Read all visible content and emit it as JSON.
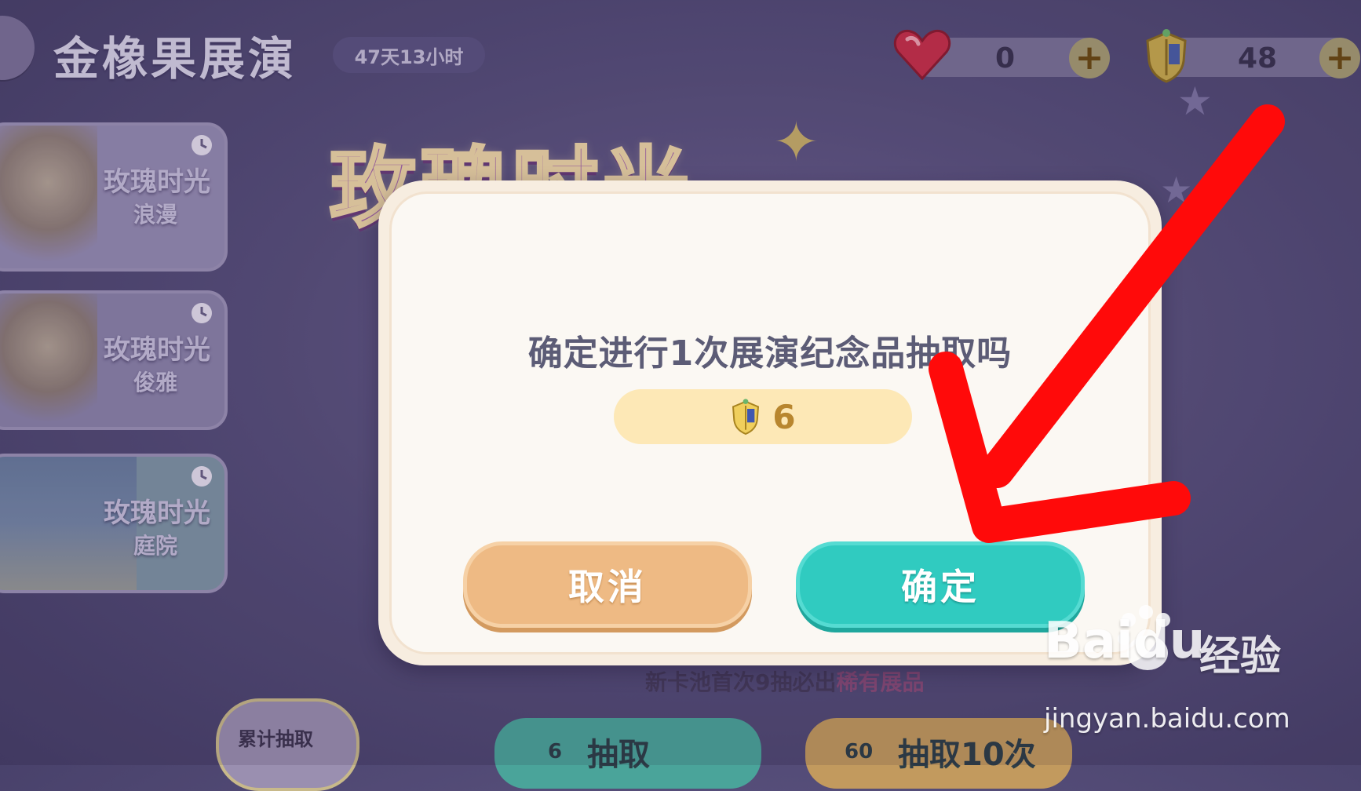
{
  "header": {
    "title": "金橡果展演",
    "countdown": "47天13小时",
    "currencies": [
      {
        "icon": "heart-gem-icon",
        "value": "0",
        "add_label": "+"
      },
      {
        "icon": "shield-token-icon",
        "value": "48",
        "add_label": "+"
      }
    ]
  },
  "sidebar": {
    "cards": [
      {
        "title": "玫瑰时光",
        "subtitle": "浪漫"
      },
      {
        "title": "玫瑰时光",
        "subtitle": "俊雅"
      },
      {
        "title": "玫瑰时光",
        "subtitle": "庭院"
      }
    ]
  },
  "banner": {
    "title": "玫瑰时光"
  },
  "background": {
    "notice_prefix": "新卡池首次9抽必出",
    "notice_highlight": "稀有展品",
    "accumulate_label": "累计抽取",
    "draw_one_label": "抽取",
    "draw_one_cost": "6",
    "draw_ten_label": "抽取10次",
    "draw_ten_cost": "60"
  },
  "dialog": {
    "question": "确定进行1次展演纪念品抽取吗",
    "cost_icon": "shield-token-icon",
    "cost_value": "6",
    "cancel_label": "取消",
    "confirm_label": "确定"
  },
  "colors": {
    "confirm_button": "#30cbc0",
    "cancel_button": "#eeba84",
    "annotation_arrow": "#ff0a0a"
  },
  "watermark": {
    "brand": "Baidu",
    "product": "经验",
    "url": "jingyan.baidu.com"
  }
}
